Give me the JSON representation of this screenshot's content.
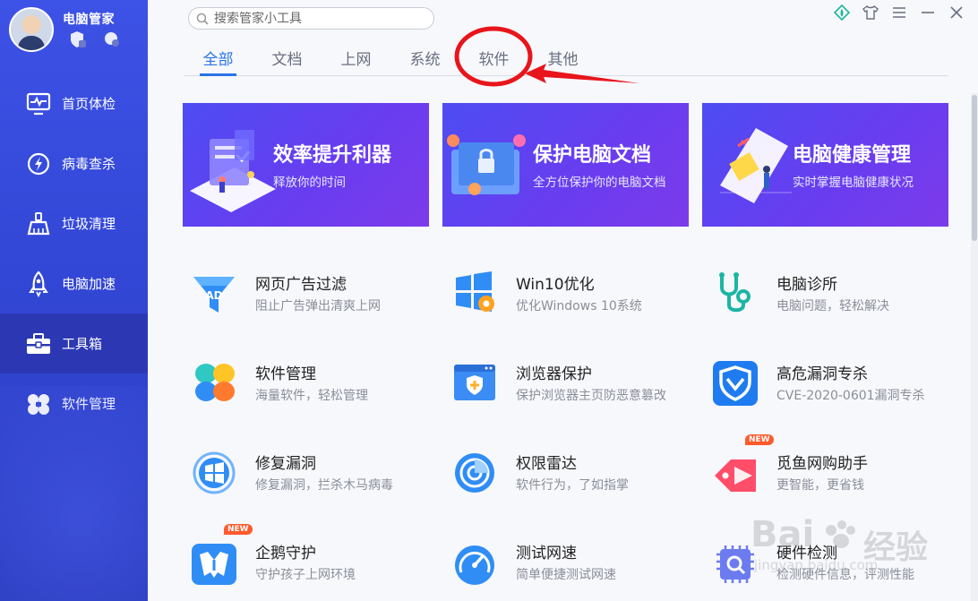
{
  "app": {
    "name": "电脑管家"
  },
  "search": {
    "placeholder": "搜索管家小工具"
  },
  "sidebar": {
    "items": [
      {
        "label": "首页体检",
        "icon": "monitor-pulse-icon"
      },
      {
        "label": "病毒查杀",
        "icon": "lightning-shield-icon"
      },
      {
        "label": "垃圾清理",
        "icon": "broom-icon"
      },
      {
        "label": "电脑加速",
        "icon": "rocket-icon"
      },
      {
        "label": "工具箱",
        "icon": "toolbox-icon",
        "active": true
      },
      {
        "label": "软件管理",
        "icon": "clover-apps-icon"
      }
    ]
  },
  "tabs": [
    {
      "label": "全部",
      "active": true
    },
    {
      "label": "文档"
    },
    {
      "label": "上网"
    },
    {
      "label": "系统"
    },
    {
      "label": "软件"
    },
    {
      "label": "其他"
    }
  ],
  "banners": [
    {
      "title": "效率提升利器",
      "subtitle": "释放你的时间"
    },
    {
      "title": "保护电脑文档",
      "subtitle": "全方位保护你的电脑文档"
    },
    {
      "title": "电脑健康管理",
      "subtitle": "实时掌握电脑健康状况"
    }
  ],
  "tools": [
    {
      "name": "网页广告过滤",
      "desc": "阻止广告弹出清爽上网",
      "icon": "ad-filter-funnel-icon",
      "badge": "AD"
    },
    {
      "name": "Win10优化",
      "desc": "优化Windows 10系统",
      "icon": "windows-gear-icon"
    },
    {
      "name": "电脑诊所",
      "desc": "电脑问题，轻松解决",
      "icon": "stethoscope-icon"
    },
    {
      "name": "软件管理",
      "desc": "海量软件，轻松管理",
      "icon": "clover-apps-icon"
    },
    {
      "name": "浏览器保护",
      "desc": "保护浏览器主页防恶意篡改",
      "icon": "browser-shield-icon"
    },
    {
      "name": "高危漏洞专杀",
      "desc": "CVE-2020-0601漏洞专杀",
      "icon": "shield-check-icon"
    },
    {
      "name": "修复漏洞",
      "desc": "修复漏洞，拦杀木马病毒",
      "icon": "windows-repair-icon"
    },
    {
      "name": "权限雷达",
      "desc": "软件行为，了如指掌",
      "icon": "radar-icon"
    },
    {
      "name": "觅鱼网购助手",
      "desc": "更智能，更省钱",
      "icon": "price-tag-icon",
      "new": "NEW"
    },
    {
      "name": "企鹅守护",
      "desc": "守护孩子上网环境",
      "icon": "penguin-guard-icon",
      "new": "NEW"
    },
    {
      "name": "测试网速",
      "desc": "简单便捷测试网速",
      "icon": "speedometer-icon"
    },
    {
      "name": "硬件检测",
      "desc": "检测硬件信息，评测性能",
      "icon": "chip-search-icon"
    }
  ],
  "watermark": {
    "text": "经验",
    "url": "jingyan.baidu.com"
  },
  "colors": {
    "sidebar": "#3347d6",
    "accent": "#2a73e8",
    "annotation": "#e8151b"
  }
}
